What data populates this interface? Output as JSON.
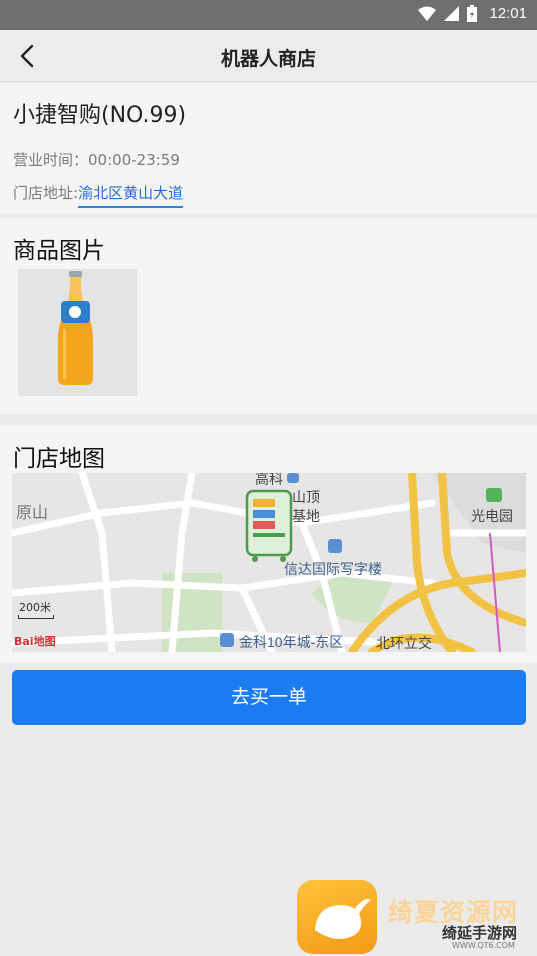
{
  "status_bar": {
    "time": "12:01"
  },
  "app_bar": {
    "title": "机器人商店"
  },
  "store": {
    "name": "小捷智购(NO.99)",
    "hours_label": "营业时间：",
    "hours_value": "00:00-23:59",
    "address_label": "门店地址:",
    "address_value": "渝北区黄山大道"
  },
  "images_section": {
    "title": "商品图片"
  },
  "map_section": {
    "title": "门店地图",
    "labels": {
      "yuanshan": "原山",
      "shanding": "山顶",
      "jidi": "基地",
      "gaoke": "高科",
      "guangdianyuan": "光电园",
      "xinda": "信达国际写字楼",
      "jinke": "金科10年城-东区",
      "beihuan": "北环立交"
    },
    "scale": "200米",
    "attribution": "Bai地图"
  },
  "buy_button": {
    "label": "去买一单"
  },
  "watermark": {
    "line1": "绮夏资源网",
    "line2": "绮延手游网",
    "line3": "WWW.QT6.COM"
  }
}
